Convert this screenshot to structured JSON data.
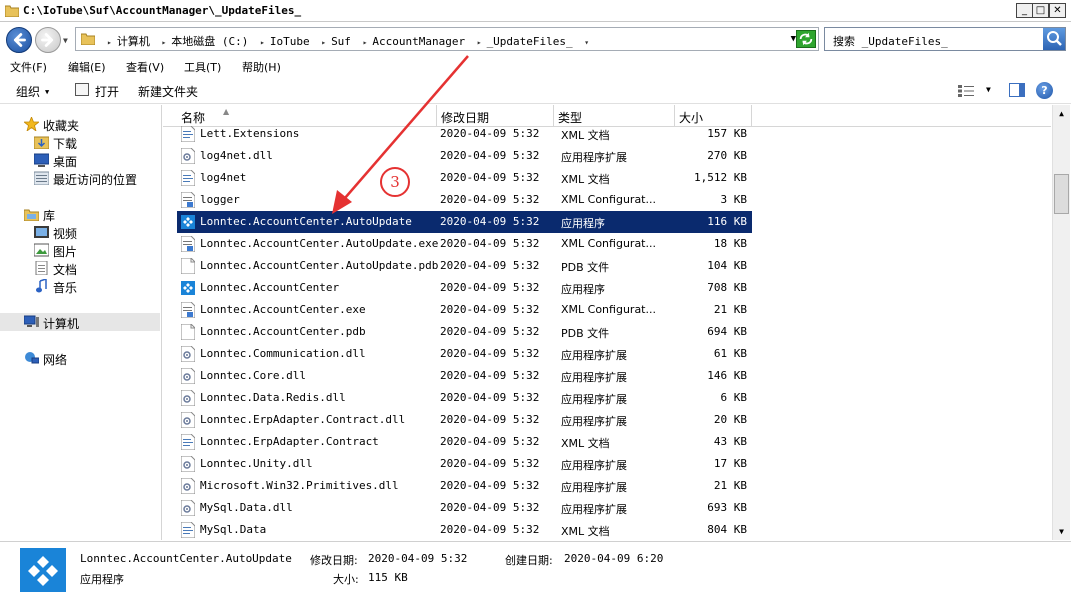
{
  "window": {
    "title": "C:\\IoTube\\Suf\\AccountManager\\_UpdateFiles_",
    "minimize": "_",
    "maximize": "□",
    "close": "✕"
  },
  "address": {
    "crumbs": [
      "计算机",
      "本地磁盘 (C:)",
      "IoTube",
      "Suf",
      "AccountManager",
      "_UpdateFiles_"
    ],
    "search_placeholder": "搜索 _UpdateFiles_"
  },
  "menu": [
    "文件(F)",
    "编辑(E)",
    "查看(V)",
    "工具(T)",
    "帮助(H)"
  ],
  "toolbar": {
    "organize": "组织",
    "open": "打开",
    "new_folder": "新建文件夹"
  },
  "nav": {
    "favorites": "收藏夹",
    "downloads": "下载",
    "desktop": "桌面",
    "recent": "最近访问的位置",
    "libraries": "库",
    "videos": "视频",
    "pictures": "图片",
    "documents": "文档",
    "music": "音乐",
    "computer": "计算机",
    "network": "网络"
  },
  "columns": {
    "name": "名称",
    "date": "修改日期",
    "type": "类型",
    "size": "大小"
  },
  "files": [
    {
      "name": "Lett.Extensions",
      "date": "2020-04-09 5:32",
      "type": "XML 文档",
      "size": "157 KB",
      "icon": "xml-icon"
    },
    {
      "name": "log4net.dll",
      "date": "2020-04-09 5:32",
      "type": "应用程序扩展",
      "size": "270 KB",
      "icon": "dll-icon"
    },
    {
      "name": "log4net",
      "date": "2020-04-09 5:32",
      "type": "XML 文档",
      "size": "1,512 KB",
      "icon": "xml-icon"
    },
    {
      "name": "logger",
      "date": "2020-04-09 5:32",
      "type": "XML Configurat...",
      "size": "3 KB",
      "icon": "config-icon"
    },
    {
      "name": "Lonntec.AccountCenter.AutoUpdate",
      "date": "2020-04-09 5:32",
      "type": "应用程序",
      "size": "116 KB",
      "icon": "app-icon",
      "selected": true
    },
    {
      "name": "Lonntec.AccountCenter.AutoUpdate.exe",
      "date": "2020-04-09 5:32",
      "type": "XML Configurat...",
      "size": "18 KB",
      "icon": "config-icon"
    },
    {
      "name": "Lonntec.AccountCenter.AutoUpdate.pdb",
      "date": "2020-04-09 5:32",
      "type": "PDB 文件",
      "size": "104 KB",
      "icon": "file-icon"
    },
    {
      "name": "Lonntec.AccountCenter",
      "date": "2020-04-09 5:32",
      "type": "应用程序",
      "size": "708 KB",
      "icon": "app-icon"
    },
    {
      "name": "Lonntec.AccountCenter.exe",
      "date": "2020-04-09 5:32",
      "type": "XML Configurat...",
      "size": "21 KB",
      "icon": "config-icon"
    },
    {
      "name": "Lonntec.AccountCenter.pdb",
      "date": "2020-04-09 5:32",
      "type": "PDB 文件",
      "size": "694 KB",
      "icon": "file-icon"
    },
    {
      "name": "Lonntec.Communication.dll",
      "date": "2020-04-09 5:32",
      "type": "应用程序扩展",
      "size": "61 KB",
      "icon": "dll-icon"
    },
    {
      "name": "Lonntec.Core.dll",
      "date": "2020-04-09 5:32",
      "type": "应用程序扩展",
      "size": "146 KB",
      "icon": "dll-icon"
    },
    {
      "name": "Lonntec.Data.Redis.dll",
      "date": "2020-04-09 5:32",
      "type": "应用程序扩展",
      "size": "6 KB",
      "icon": "dll-icon"
    },
    {
      "name": "Lonntec.ErpAdapter.Contract.dll",
      "date": "2020-04-09 5:32",
      "type": "应用程序扩展",
      "size": "20 KB",
      "icon": "dll-icon"
    },
    {
      "name": "Lonntec.ErpAdapter.Contract",
      "date": "2020-04-09 5:32",
      "type": "XML 文档",
      "size": "43 KB",
      "icon": "xml-icon"
    },
    {
      "name": "Lonntec.Unity.dll",
      "date": "2020-04-09 5:32",
      "type": "应用程序扩展",
      "size": "17 KB",
      "icon": "dll-icon"
    },
    {
      "name": "Microsoft.Win32.Primitives.dll",
      "date": "2020-04-09 5:32",
      "type": "应用程序扩展",
      "size": "21 KB",
      "icon": "dll-icon"
    },
    {
      "name": "MySql.Data.dll",
      "date": "2020-04-09 5:32",
      "type": "应用程序扩展",
      "size": "693 KB",
      "icon": "dll-icon"
    },
    {
      "name": "MySql.Data",
      "date": "2020-04-09 5:32",
      "type": "XML 文档",
      "size": "804 KB",
      "icon": "xml-icon"
    }
  ],
  "details": {
    "name": "Lonntec.AccountCenter.AutoUpdate",
    "type": "应用程序",
    "modified_label": "修改日期:",
    "modified_value": "2020-04-09 5:32",
    "created_label": "创建日期:",
    "created_value": "2020-04-09 6:20",
    "size_label": "大小:",
    "size_value": "115 KB"
  },
  "annotation": {
    "step": "3",
    "color": "#e53232"
  },
  "colors": {
    "selection": "#0a2a6e",
    "accent": "#1a84d8"
  }
}
